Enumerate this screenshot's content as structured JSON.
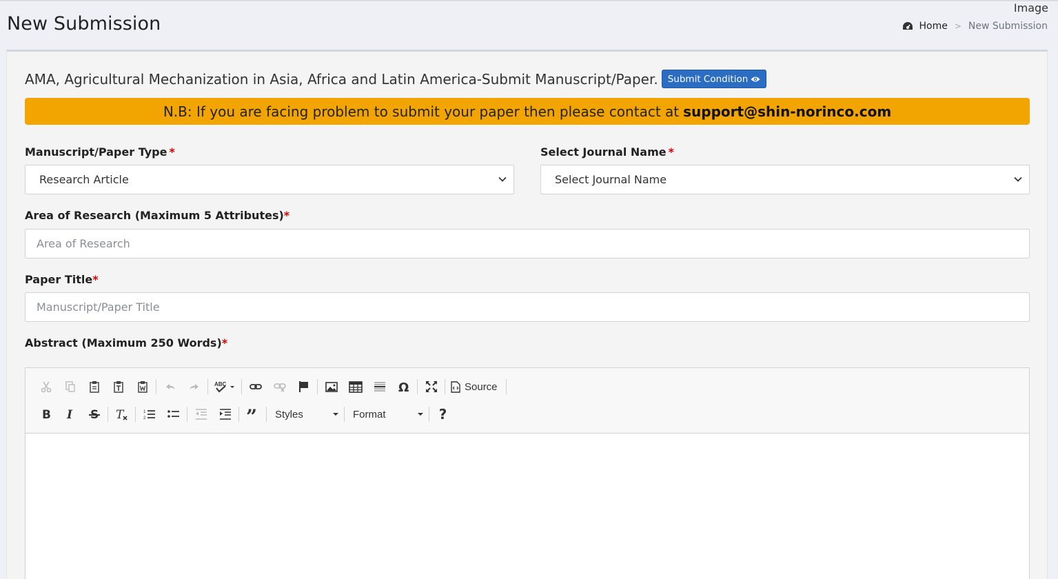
{
  "top_label": "Image",
  "page_title": "New Submission",
  "breadcrumb": {
    "home": "Home",
    "separator": ">",
    "current": "New Submission"
  },
  "heading": "AMA, Agricultural Mechanization in Asia, Africa and Latin America-Submit Manuscript/Paper.",
  "submit_condition_label": "Submit Condition",
  "notice": {
    "text": "N.B: If you are facing problem to submit your paper then please contact at",
    "email": "support@shin-norinco.com"
  },
  "fields": {
    "paper_type": {
      "label": "Manuscript/Paper Type",
      "required": "*",
      "value": "Research Article"
    },
    "journal": {
      "label": "Select Journal Name",
      "required": "*",
      "value": "Select Journal Name"
    },
    "area": {
      "label": "Area of Research (Maximum 5 Attributes)",
      "required": "*",
      "placeholder": "Area of Research"
    },
    "title": {
      "label": "Paper Title",
      "required": "*",
      "placeholder": "Manuscript/Paper Title"
    },
    "abstract": {
      "label": "Abstract (Maximum 250 Words)",
      "required": "*"
    }
  },
  "editor": {
    "source_label": "Source",
    "styles_label": "Styles",
    "format_label": "Format",
    "help_label": "?"
  },
  "colors": {
    "accent_blue": "#2a6dc2",
    "notice_bg": "#f2a500",
    "required_red": "#dd0000"
  }
}
